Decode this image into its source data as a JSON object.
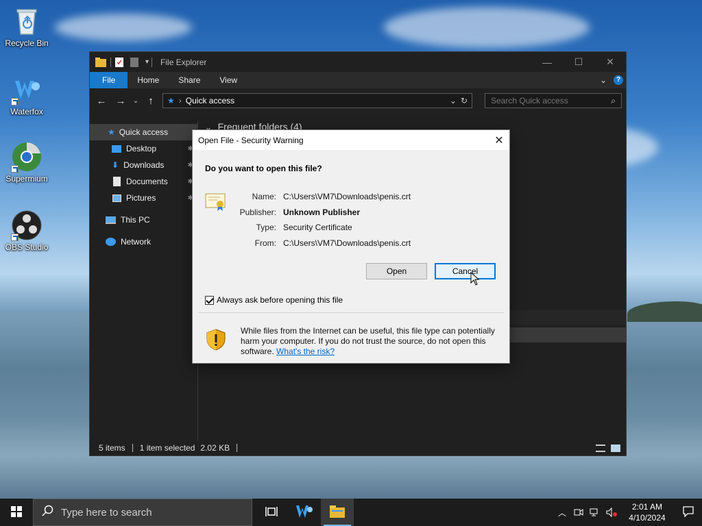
{
  "desktop": {
    "icons": [
      {
        "label": "Recycle Bin"
      },
      {
        "label": "Waterfox"
      },
      {
        "label": "Supermium"
      },
      {
        "label": "OBS Studio"
      }
    ]
  },
  "explorer": {
    "title": "File Explorer",
    "window_buttons": {
      "minimize": "—",
      "maximize": "☐",
      "close": "✕"
    },
    "ribbon_tabs": [
      "File",
      "Home",
      "Share",
      "View"
    ],
    "address": {
      "path": "Quick access"
    },
    "search": {
      "placeholder": "Search Quick access"
    },
    "nav": {
      "quick_access": "Quick access",
      "items": [
        "Desktop",
        "Downloads",
        "Documents",
        "Pictures"
      ],
      "this_pc": "This PC",
      "network": "Network"
    },
    "content": {
      "frequent_header": "Frequent folders (4)"
    },
    "status": {
      "items": "5 items",
      "selected": "1 item selected",
      "size": "2.02 KB"
    }
  },
  "dialog": {
    "title": "Open File - Security Warning",
    "question": "Do you want to open this file?",
    "fields": {
      "name_label": "Name:",
      "name_value": "C:\\Users\\VM7\\Downloads\\penis.crt",
      "publisher_label": "Publisher:",
      "publisher_value": "Unknown Publisher",
      "type_label": "Type:",
      "type_value": "Security Certificate",
      "from_label": "From:",
      "from_value": "C:\\Users\\VM7\\Downloads\\penis.crt"
    },
    "open_label": "Open",
    "cancel_label": "Cancel",
    "always_ask_label": "Always ask before opening this file",
    "always_ask_checked": true,
    "warning_text": "While files from the Internet can be useful, this file type can potentially harm your computer. If you do not trust the source, do not open this software.",
    "risk_link": "What's the risk?"
  },
  "taskbar": {
    "search_placeholder": "Type here to search",
    "time": "2:01 AM",
    "date": "4/10/2024"
  },
  "colors": {
    "accent": "#1979ca",
    "dialog_default_border": "#0078d7",
    "link": "#0066cc"
  }
}
